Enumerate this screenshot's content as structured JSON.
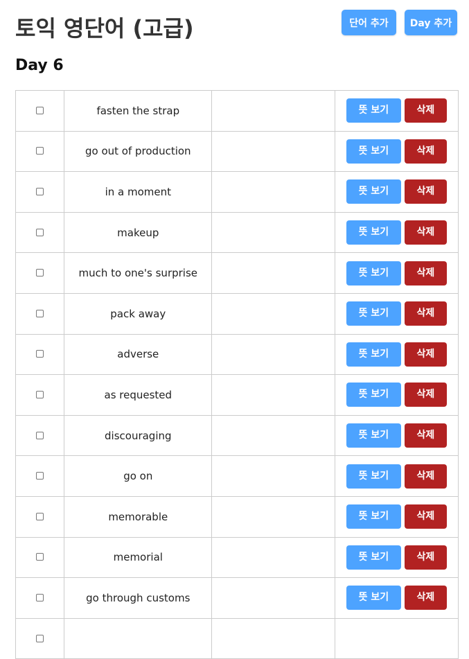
{
  "header": {
    "title": "토익 영단어 (고급)",
    "add_word_label": "단어 추가",
    "add_day_label": "Day 추가"
  },
  "day": {
    "title": "Day 6"
  },
  "row_actions": {
    "meaning_label": "뜻 보기",
    "delete_label": "삭제"
  },
  "words": [
    {
      "word": "fasten the strap"
    },
    {
      "word": "go out of production"
    },
    {
      "word": "in a moment"
    },
    {
      "word": "makeup"
    },
    {
      "word": "much to one's surprise"
    },
    {
      "word": "pack away"
    },
    {
      "word": "adverse"
    },
    {
      "word": "as requested"
    },
    {
      "word": "discouraging"
    },
    {
      "word": "go on"
    },
    {
      "word": "memorable"
    },
    {
      "word": "memorial"
    },
    {
      "word": "go through customs"
    },
    {
      "word": ""
    }
  ],
  "colors": {
    "primary": "#4da3ff",
    "danger": "#b22222",
    "border": "#cccccc"
  }
}
